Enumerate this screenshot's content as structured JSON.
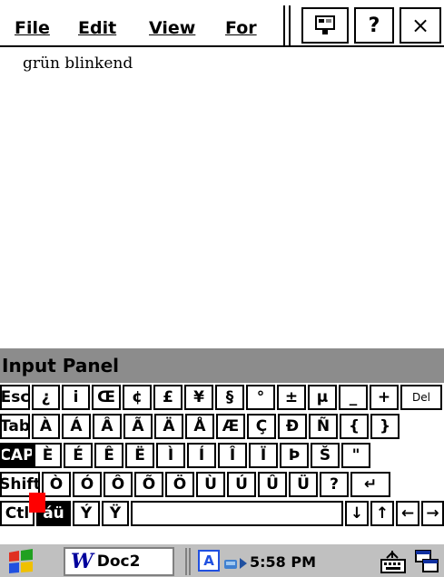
{
  "menu": {
    "file": "File",
    "edit": "Edit",
    "view": "View",
    "format": "For"
  },
  "toolbar": {
    "help": "?",
    "close": "×"
  },
  "document": {
    "text": "grün blinkend"
  },
  "input_panel": {
    "title": "Input Panel"
  },
  "keyboard": {
    "row1": [
      "Esc",
      "¿",
      "i",
      "Œ",
      "¢",
      "£",
      "¥",
      "§",
      "°",
      "±",
      "µ",
      "_",
      "+",
      "Del"
    ],
    "row2": [
      "Tab",
      "À",
      "Á",
      "Â",
      "Ã",
      "Ä",
      "Å",
      "Æ",
      "Ç",
      "Ð",
      "Ñ",
      "{",
      "}"
    ],
    "row3": [
      "CAP",
      "È",
      "É",
      "Ê",
      "Ë",
      "Ì",
      "Í",
      "Î",
      "Ï",
      "Þ",
      "Š",
      "\""
    ],
    "row4": [
      "Shift",
      "Ò",
      "Ó",
      "Ô",
      "Õ",
      "Ö",
      "Ù",
      "Ú",
      "Û",
      "Ü",
      "?",
      "↵"
    ],
    "row5": [
      "Ctl",
      "áü",
      "Ý",
      "Ÿ",
      "",
      "↓",
      "↑",
      "←",
      "→"
    ]
  },
  "taskbar": {
    "task_label": "Doc2",
    "task_letter": "W",
    "input_indicator": "A",
    "time": "5:58 PM"
  }
}
